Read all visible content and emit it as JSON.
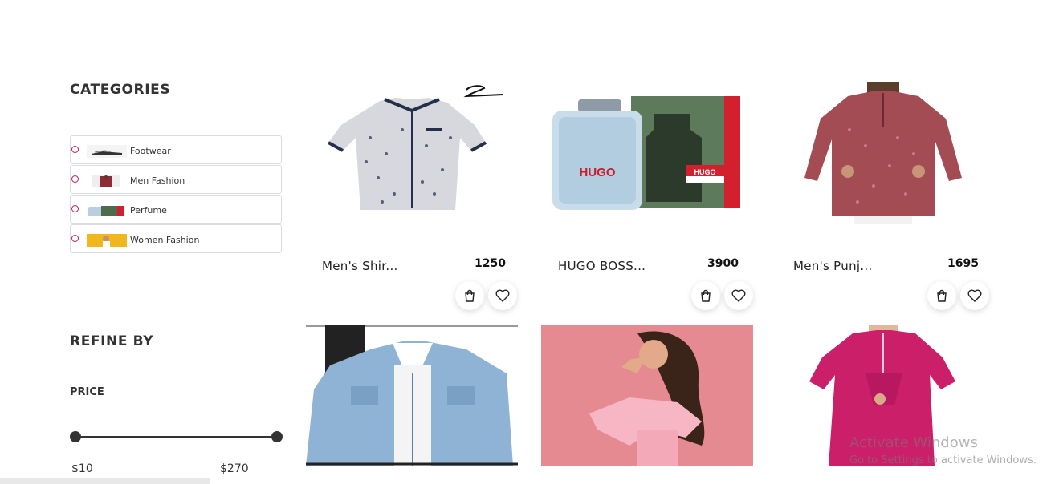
{
  "sidebar": {
    "categories_title": "CATEGORIES",
    "categories": [
      {
        "label": "Footwear"
      },
      {
        "label": "Men Fashion"
      },
      {
        "label": "Perfume"
      },
      {
        "label": "Women Fashion"
      }
    ],
    "refine_title": "REFINE BY",
    "price_title": "PRICE",
    "price_min": "$10",
    "price_max": "$270"
  },
  "products": [
    {
      "name": "Men's Shir...",
      "price": "1250"
    },
    {
      "name": "HUGO BOSS...",
      "price": "3900"
    },
    {
      "name": "Men's Punj...",
      "price": "1695"
    }
  ],
  "watermark": {
    "title": "Activate Windows",
    "subtitle": "Go to Settings to activate Windows."
  },
  "colors": {
    "accent": "#c2185b",
    "text": "#333333",
    "border": "#dcdcdc"
  }
}
